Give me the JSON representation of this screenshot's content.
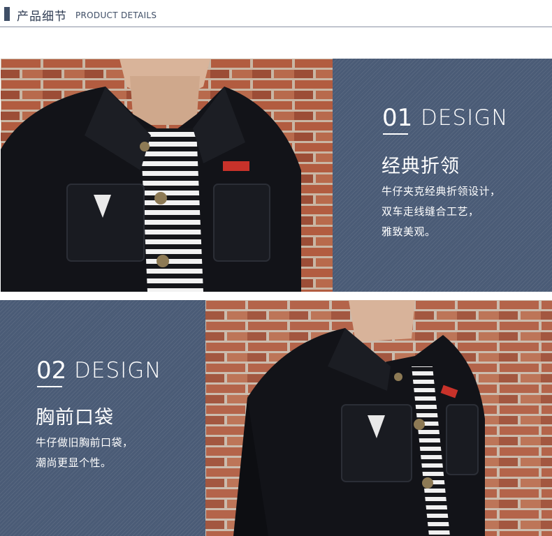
{
  "header": {
    "title_cn": "产品细节",
    "title_en": "PRODUCT DETAILS"
  },
  "sections": [
    {
      "number": "01",
      "design_word": "DESIGN",
      "feature_title": "经典折领",
      "description_lines": [
        "牛仔夹克经典折领设计，",
        "双车走线缝合工艺，",
        "雅致美观。"
      ]
    },
    {
      "number": "02",
      "design_word": "DESIGN",
      "feature_title": "胸前口袋",
      "description_lines": [
        "牛仔做旧胸前口袋，",
        "潮尚更显个性。"
      ]
    }
  ],
  "colors": {
    "panel_blue": "#4a5b76",
    "header_text": "#2e3b52",
    "brick": "#a9583f",
    "jacket": "#111318"
  }
}
